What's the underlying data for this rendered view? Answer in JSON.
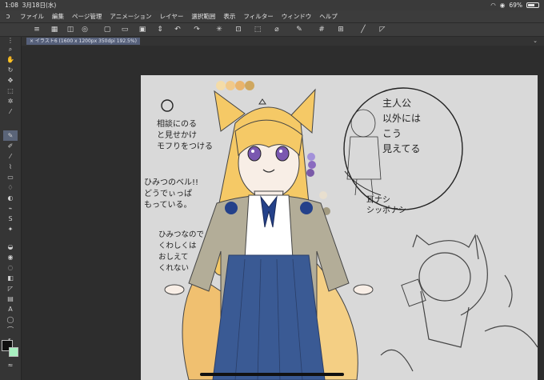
{
  "status": {
    "time": "1:08",
    "date": "3月18日(水)",
    "battery": "69%",
    "battery_level": 0.69
  },
  "menu": [
    "ファイル",
    "編集",
    "ページ管理",
    "アニメーション",
    "レイヤー",
    "選択範囲",
    "表示",
    "フィルター",
    "ウィンドウ",
    "ヘルプ"
  ],
  "document_tab": "× イラスト6 (1600 x 1200px 350dpi 192.5%)",
  "canvas_text": {
    "note1": "相談にのる\nと見せかけ\nモフりをつける",
    "note2": "ひみつのベル!!\nどうでぃっぱ\nもっている。",
    "note3": "ひみつなので\nくわしくは\nおしえて\nくれない",
    "bubble": "主人公\n以外には\nこう\n見えてる",
    "bubble2": "耳ナシ\nシッポナシ"
  },
  "colors": {
    "accent": "#56607a",
    "palette": [
      "#f4dca8",
      "#f1c98a",
      "#e9b46d",
      "#cfa75f",
      "#a391d9",
      "#8a6bbf",
      "#7a5aa8",
      "#e8dfcf",
      "#a29a80"
    ]
  }
}
